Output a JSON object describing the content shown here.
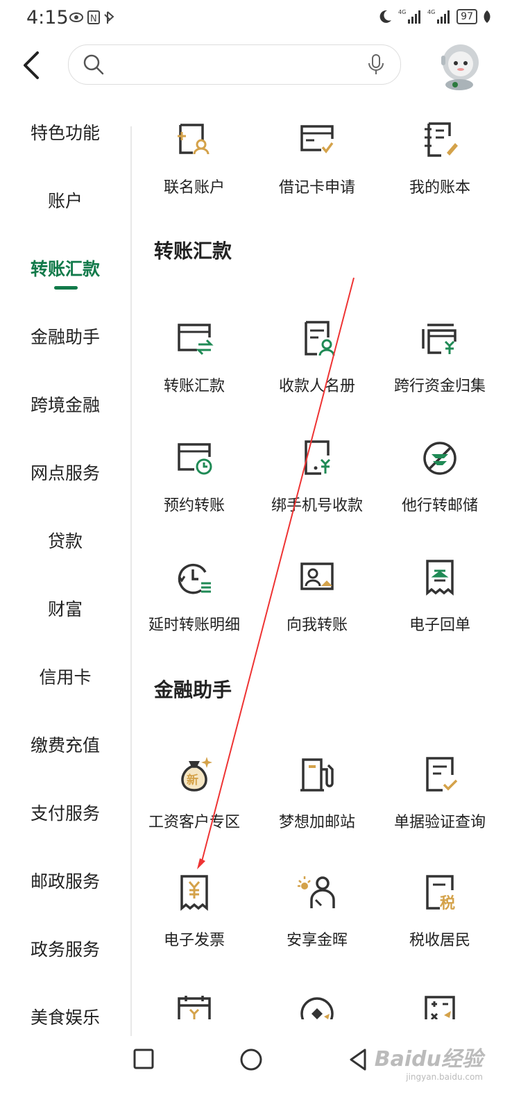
{
  "status_bar": {
    "time": "4:15",
    "battery": "97"
  },
  "sidebar": {
    "items": [
      {
        "label": "特色功能"
      },
      {
        "label": "账户"
      },
      {
        "label": "转账汇款"
      },
      {
        "label": "金融助手"
      },
      {
        "label": "跨境金融"
      },
      {
        "label": "网点服务"
      },
      {
        "label": "贷款"
      },
      {
        "label": "财富"
      },
      {
        "label": "信用卡"
      },
      {
        "label": "缴费充值"
      },
      {
        "label": "支付服务"
      },
      {
        "label": "邮政服务"
      },
      {
        "label": "政务服务"
      },
      {
        "label": "美食娱乐"
      }
    ],
    "active_index": 2
  },
  "content": {
    "top_row": [
      "联名账户",
      "借记卡申请",
      "我的账本"
    ],
    "transfer": {
      "title": "转账汇款",
      "items": [
        "转账汇款",
        "收款人名册",
        "跨行资金归集",
        "预约转账",
        "绑手机号收款",
        "他行转邮储",
        "延时转账明细",
        "向我转账",
        "电子回单"
      ]
    },
    "assistant": {
      "title": "金融助手",
      "items": [
        "工资客户专区",
        "梦想加邮站",
        "单据验证查询",
        "电子发票",
        "安享金晖",
        "税收居民"
      ]
    }
  },
  "watermark": {
    "brand": "Baidu经验",
    "url": "jingyan.baidu.com"
  },
  "colors": {
    "accent": "#117a4a",
    "icon_gold": "#d4a24a",
    "arrow": "#e33"
  }
}
